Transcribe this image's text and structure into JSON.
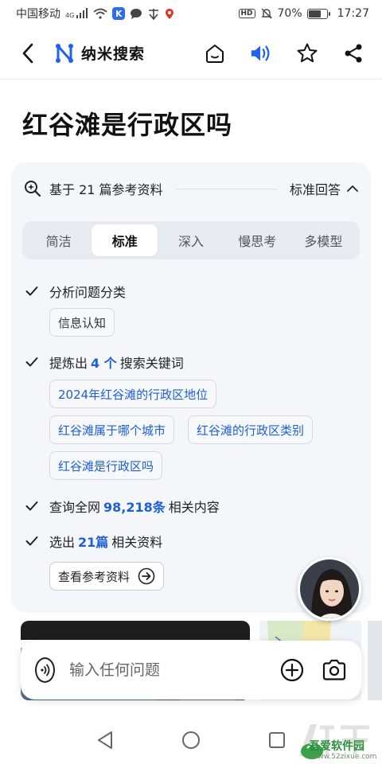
{
  "status_bar": {
    "carrier": "中国移动",
    "network": "4G",
    "hd": "HD",
    "battery_percent": "70%",
    "battery_level": 0.7,
    "time": "17:27"
  },
  "nav": {
    "brand_name": "纳米搜索",
    "brand_color": "#1e63f0",
    "icons": [
      "back-icon",
      "home-icon",
      "speaker-icon",
      "star-icon",
      "share-icon"
    ]
  },
  "page": {
    "title": "红谷滩是行政区吗"
  },
  "answer": {
    "ref_label": "基于 21 篇参考资料",
    "mode_label": "标准回答",
    "tabs": [
      {
        "label": "简洁",
        "active": false
      },
      {
        "label": "标准",
        "active": true
      },
      {
        "label": "深入",
        "active": false
      },
      {
        "label": "慢思考",
        "active": false
      },
      {
        "label": "多模型",
        "active": false
      }
    ],
    "step1": {
      "text": "分析问题分类"
    },
    "category_chip": "信息认知",
    "step2": {
      "prefix": "提炼出",
      "highlight": "4 个",
      "suffix": "搜索关键词"
    },
    "keywords": [
      "2024年红谷滩的行政区地位",
      "红谷滩属于哪个城市",
      "红谷滩的行政区类别",
      "红谷滩是行政区吗"
    ],
    "step3": {
      "prefix": "查询全网",
      "highlight": "98,218条",
      "suffix": "相关内容"
    },
    "step4": {
      "prefix": "选出",
      "highlight": "21篇",
      "suffix": "相关资料"
    },
    "view_refs_label": "查看参考资料",
    "highlight_color": "#1c5fd6"
  },
  "input": {
    "placeholder": "输入任何问题"
  },
  "watermark": {
    "brand": "吾爱软件园",
    "url": "www.52zixue.com"
  }
}
